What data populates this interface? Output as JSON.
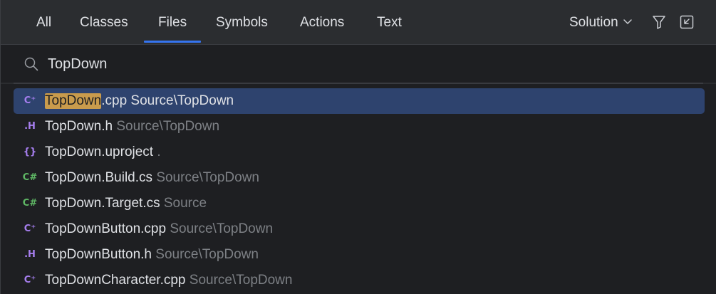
{
  "tabs": [
    {
      "label": "All",
      "active": false
    },
    {
      "label": "Classes",
      "active": false
    },
    {
      "label": "Files",
      "active": true
    },
    {
      "label": "Symbols",
      "active": false
    },
    {
      "label": "Actions",
      "active": false
    },
    {
      "label": "Text",
      "active": false
    }
  ],
  "scope": {
    "label": "Solution",
    "icon": "chevron-down-icon"
  },
  "toolbar": {
    "filter_icon": "filter-icon",
    "open_in_window_icon": "open-in-tool-window-icon"
  },
  "search": {
    "icon": "search-icon",
    "value": "TopDown",
    "placeholder": ""
  },
  "results": [
    {
      "icon": "cpp-file-icon",
      "icon_glyph": "C⁺",
      "match": "TopDown",
      "rest": ".cpp",
      "path": "Source\\TopDown",
      "selected": true
    },
    {
      "icon": "header-file-icon",
      "icon_glyph": ".H",
      "match": "",
      "rest": "TopDown.h",
      "path": "Source\\TopDown",
      "selected": false
    },
    {
      "icon": "json-file-icon",
      "icon_glyph": "{}",
      "match": "",
      "rest": "TopDown.uproject",
      "path": ".",
      "selected": false
    },
    {
      "icon": "csharp-file-icon",
      "icon_glyph": "C#",
      "match": "",
      "rest": "TopDown.Build.cs",
      "path": "Source\\TopDown",
      "selected": false
    },
    {
      "icon": "csharp-file-icon",
      "icon_glyph": "C#",
      "match": "",
      "rest": "TopDown.Target.cs",
      "path": "Source",
      "selected": false
    },
    {
      "icon": "cpp-file-icon",
      "icon_glyph": "C⁺",
      "match": "",
      "rest": "TopDownButton.cpp",
      "path": "Source\\TopDown",
      "selected": false
    },
    {
      "icon": "header-file-icon",
      "icon_glyph": ".H",
      "match": "",
      "rest": "TopDownButton.h",
      "path": "Source\\TopDown",
      "selected": false
    },
    {
      "icon": "cpp-file-icon",
      "icon_glyph": "C⁺",
      "match": "",
      "rest": "TopDownCharacter.cpp",
      "path": "Source\\TopDown",
      "selected": false
    }
  ],
  "colors": {
    "accent": "#3574f0",
    "selection": "#2e436e",
    "match_highlight": "#c99b4c",
    "cpp_icon": "#a77ff0",
    "cs_icon": "#5fb865",
    "path_text": "#7d8085"
  }
}
